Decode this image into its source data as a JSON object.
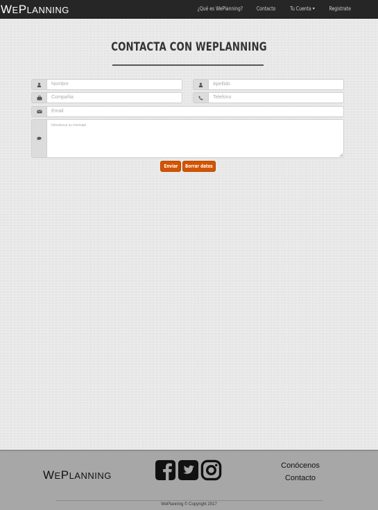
{
  "navbar": {
    "brand_initial1": "W",
    "brand_rest1": "E",
    "brand_initial2": "P",
    "brand_rest2": "LANNING",
    "links": [
      {
        "label": "¿Qué es WePlanning?"
      },
      {
        "label": "Contacto"
      },
      {
        "label": "Tu Cuenta",
        "dropdown": true
      },
      {
        "label": "Registrate"
      }
    ]
  },
  "page": {
    "title": "CONTACTA CON WEPLANNING"
  },
  "form": {
    "nombre_placeholder": "Nombre",
    "apellido_placeholder": "Apellido",
    "compania_placeholder": "Compañia",
    "telefono_placeholder": "Telefono",
    "email_placeholder": "Email",
    "mensaje_placeholder": "Introduzca su mensaje",
    "submit_label": "Enviar",
    "clear_label": "Borrar datos",
    "icons": {
      "nombre": "user-icon",
      "apellido": "user-icon",
      "compania": "briefcase-icon",
      "telefono": "phone-icon",
      "email": "envelope-icon",
      "mensaje": "comment-icon"
    }
  },
  "footer": {
    "brand_initial1": "W",
    "brand_rest1": "E",
    "brand_initial2": "P",
    "brand_rest2": "LANNING",
    "social_icons": [
      "facebook-icon",
      "twitter-icon",
      "instagram-icon"
    ],
    "links": [
      {
        "label": "Conócenos"
      },
      {
        "label": "Contacto"
      }
    ],
    "copyright": "WePlanning © Copyright 2017"
  },
  "colors": {
    "accent": "#d35400",
    "navbar_bg": "#262626",
    "footer_bg": "#a7a7a7",
    "page_bg": "#e8e8e8"
  }
}
